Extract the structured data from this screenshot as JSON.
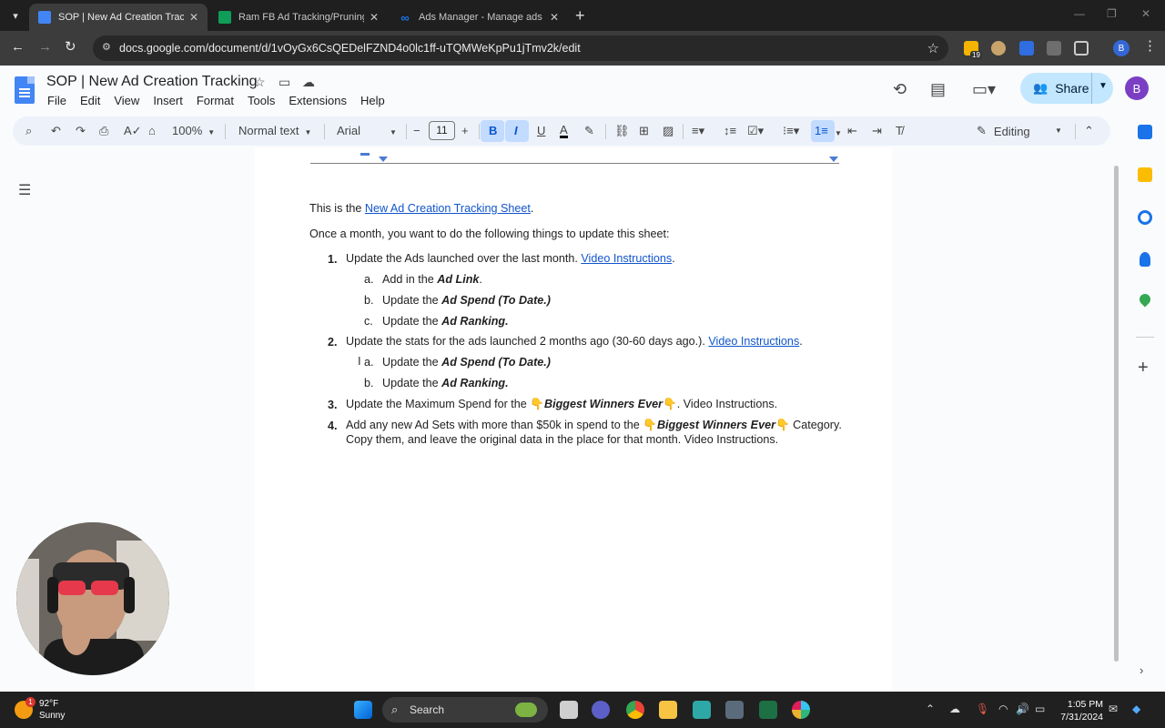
{
  "browser": {
    "tabs": [
      {
        "title": "SOP | New Ad Creation Tracking",
        "active": true,
        "icon": "google-docs-icon"
      },
      {
        "title": "Ram FB Ad Tracking/Pruning Sh",
        "active": false,
        "icon": "google-sheets-icon"
      },
      {
        "title": "Ads Manager - Manage ads - A",
        "active": false,
        "icon": "meta-icon"
      }
    ],
    "url": "docs.google.com/document/d/1vOyGx6CsQEDelFZND4o0lc1ff-uTQMWeKpPu1jTmv2k/edit",
    "ext_badge": "19",
    "profile_letter": "B"
  },
  "docs": {
    "title": "SOP | New Ad Creation Tracking",
    "menu": [
      "File",
      "Edit",
      "View",
      "Insert",
      "Format",
      "Tools",
      "Extensions",
      "Help"
    ],
    "share_label": "Share",
    "account_letter": "B"
  },
  "toolbar": {
    "zoom": "100%",
    "style": "Normal text",
    "font": "Arial",
    "font_size": "11",
    "mode": "Editing"
  },
  "document": {
    "intro_prefix": "This is the ",
    "intro_link": "New Ad Creation Tracking Sheet",
    "intro_suffix": ".",
    "lead": "Once a month, you want to do the following things to update this sheet:",
    "items": [
      {
        "num": "1.",
        "text": "Update the Ads launched over the last month. ",
        "link": "Video Instructions",
        "after": ".",
        "sub": [
          {
            "letter": "a.",
            "text": "Add in the ",
            "bold": "Ad Link",
            "after": "."
          },
          {
            "letter": "b.",
            "text": "Update the ",
            "bold": "Ad Spend (To Date.)",
            "after": ""
          },
          {
            "letter": "c.",
            "text": "Update the ",
            "bold": "Ad Ranking.",
            "after": ""
          }
        ]
      },
      {
        "num": "2.",
        "text": "Update the stats for the ads launched 2 months ago (30-60 days ago.). ",
        "link": "Video Instructions",
        "after": ".",
        "sub": [
          {
            "letter": "a.",
            "text": "Update the ",
            "bold": "Ad Spend (To Date.)",
            "after": ""
          },
          {
            "letter": "b.",
            "text": "Update the ",
            "bold": "Ad Ranking.",
            "after": ""
          }
        ]
      },
      {
        "num": "3.",
        "text": "Update the Maximum Spend for the ",
        "emoji": "👇",
        "bold": "Biggest Winners Ever",
        "after": ". Video Instructions."
      },
      {
        "num": "4.",
        "text": "Add any new Ad Sets with more than $50k in spend to the ",
        "emoji": "👇",
        "bold": "Biggest Winners Ever",
        "after": " Category.",
        "line2": "Copy them, and leave the original data in the place for that month. Video Instructions."
      }
    ]
  },
  "taskbar": {
    "weather_temp": "92°F",
    "weather_desc": "Sunny",
    "weather_badge": "1",
    "search_label": "Search",
    "time": "1:05 PM",
    "date": "7/31/2024"
  }
}
